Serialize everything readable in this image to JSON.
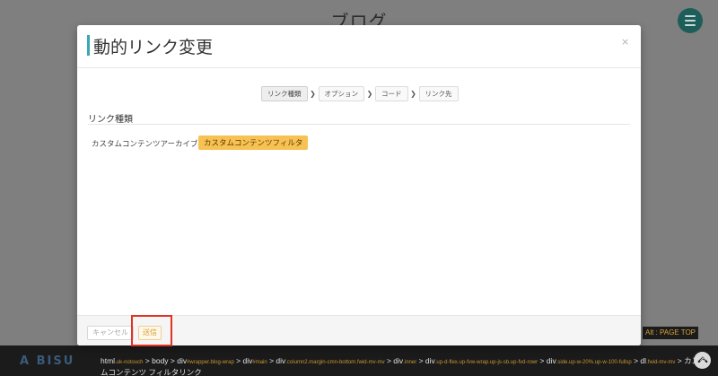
{
  "background": {
    "page_title": "ブログ",
    "brand": "A BISU",
    "pagetop_label": "Alt : PAGE TOP",
    "breadcrumb": [
      {
        "t": "html",
        "c": ".uk-notouch"
      },
      {
        "t": " > body > div",
        "c": "#wrapper.blog-wrap"
      },
      {
        "t": " > div",
        "c": "#main"
      },
      {
        "t": " > div",
        "c": ".column2.margin-cmn-bottom.fwid-mv-mv"
      },
      {
        "t": " > div",
        "c": ".inner"
      },
      {
        "t": " > div",
        "c": ".up-d-flex.up-fvw-wrap.up-js-sb.up-fvd-rowr"
      },
      {
        "t": " > div",
        "c": ".side.up-w-20%.up-w-100-fullsp"
      },
      {
        "t": " > dl",
        "c": ".fwid-mv-mv"
      },
      {
        "t": " > カスタムコンテンツ フィルタリンク",
        "c": ""
      }
    ]
  },
  "modal": {
    "title": "動的リンク変更",
    "close_label": "×",
    "steps": [
      "リンク種類",
      "オプション",
      "コード",
      "リンク先"
    ],
    "active_step": 0,
    "section_title": "リンク種類",
    "link_types": [
      {
        "label": "カスタムコンテンツアーカイブ",
        "selected": false
      },
      {
        "label": "カスタムコンテンツフィルタ",
        "selected": true
      }
    ],
    "footer": {
      "cancel_label": "キャンセル",
      "send_label": "送信"
    }
  },
  "colors": {
    "accent": "#3aa7b5",
    "chip": "#f7c153",
    "highlight": "#e03323",
    "send_text": "#d69e34"
  }
}
